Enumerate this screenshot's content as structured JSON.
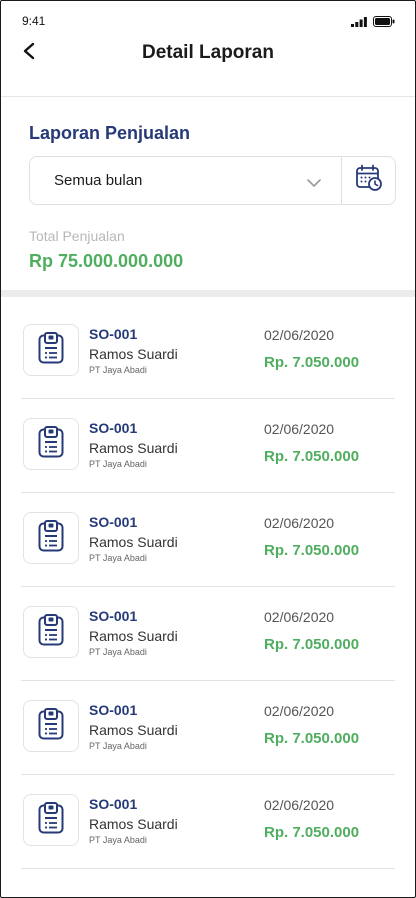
{
  "status_bar": {
    "time": "9:41"
  },
  "header": {
    "title": "Detail Laporan"
  },
  "report": {
    "section_title": "Laporan Penjualan",
    "month_filter": "Semua bulan",
    "total_label": "Total Penjualan",
    "total_value": "Rp 75.000.000.000"
  },
  "orders": [
    {
      "code": "SO-001",
      "name": "Ramos Suardi",
      "company": "PT Jaya Abadi",
      "date": "02/06/2020",
      "amount": "Rp. 7.050.000"
    },
    {
      "code": "SO-001",
      "name": "Ramos Suardi",
      "company": "PT Jaya Abadi",
      "date": "02/06/2020",
      "amount": "Rp. 7.050.000"
    },
    {
      "code": "SO-001",
      "name": "Ramos Suardi",
      "company": "PT Jaya Abadi",
      "date": "02/06/2020",
      "amount": "Rp. 7.050.000"
    },
    {
      "code": "SO-001",
      "name": "Ramos Suardi",
      "company": "PT Jaya Abadi",
      "date": "02/06/2020",
      "amount": "Rp. 7.050.000"
    },
    {
      "code": "SO-001",
      "name": "Ramos Suardi",
      "company": "PT Jaya Abadi",
      "date": "02/06/2020",
      "amount": "Rp. 7.050.000"
    },
    {
      "code": "SO-001",
      "name": "Ramos Suardi",
      "company": "PT Jaya Abadi",
      "date": "02/06/2020",
      "amount": "Rp. 7.050.000"
    }
  ],
  "colors": {
    "primary": "#263a78",
    "accent_green": "#4fae5f",
    "muted_text": "#b8b8b8"
  },
  "icons": {
    "back": "arrow-left-icon",
    "dropdown": "chevron-down-icon",
    "calendar": "calendar-clock-icon",
    "document": "document-icon",
    "signal": "signal-icon",
    "battery": "battery-icon"
  }
}
